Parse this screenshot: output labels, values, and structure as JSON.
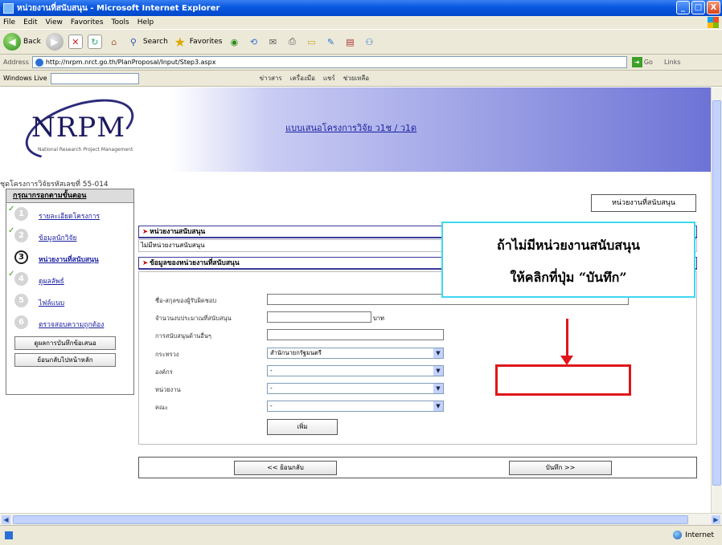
{
  "window": {
    "title": "หน่วยงานที่สนับสนุน - Microsoft Internet Explorer",
    "buttons": [
      "_",
      "□",
      "X"
    ]
  },
  "menubar": [
    "File",
    "Edit",
    "View",
    "Favorites",
    "Tools",
    "Help"
  ],
  "toolbar": {
    "back_label": "Back",
    "search_label": "Search",
    "favorites_label": "Favorites"
  },
  "addressbar": {
    "label": "Address",
    "url": "http://nrpm.nrct.go.th/PlanProposal/Input/Step3.aspx",
    "go_label": "Go",
    "links_label": "Links"
  },
  "livebar": {
    "brand": "Windows Live",
    "links": [
      "ข่าวสาร",
      "เครื่องมือ",
      "แชร์",
      "ช่วยเหลือ"
    ]
  },
  "page": {
    "banner_title": "แบบเสนอโครงการวิจัย ว1ช / ว1ด",
    "logo_text": "NRPM",
    "logo_tagline": "National Research Project Management",
    "project_line": "ชุดโครงการวิจัยรหัสเลขที่ 55-014"
  },
  "sidebar": {
    "heading": "กรุณากรอกตามขั้นตอน",
    "steps": [
      {
        "num": "1",
        "label": "รายละเอียดโครงการ",
        "done": true
      },
      {
        "num": "2",
        "label": "ข้อมูลนักวิจัย",
        "done": true
      },
      {
        "num": "3",
        "label": "หน่วยงานที่สนับสนุน",
        "done": false
      },
      {
        "num": "4",
        "label": "ดูผลลัพธ์",
        "done": true
      },
      {
        "num": "5",
        "label": "ไฟล์แนบ",
        "done": false
      },
      {
        "num": "6",
        "label": "ตรวจสอบความถูกต้อง",
        "done": false
      }
    ],
    "buttons": [
      "ดูผลการบันทึกข้อเสนอ",
      "ย้อนกลับไปหน้าหลัก"
    ]
  },
  "tab_label": "หน่วยงานที่สนับสนุน",
  "sections": {
    "s1_head": "หน่วยงานสนับสนุน",
    "s1_row": "ไม่มีหน่วยงานสนับสนุน",
    "s2_head": "ข้อมูลของหน่วยงานที่สนับสนุน"
  },
  "form": {
    "fields": [
      {
        "label": "ชื่อ-สกุลของผู้รับผิดชอบ"
      },
      {
        "label": "จำนวนงบประมาณที่สนับสนุน",
        "unit": "บาท"
      },
      {
        "label": "การสนับสนุนด้านอื่นๆ"
      },
      {
        "label": "กระทรวง",
        "value": "สำนักนายกรัฐมนตรี"
      },
      {
        "label": "องค์กร",
        "value": "-"
      },
      {
        "label": "หน่วยงาน",
        "value": "-"
      },
      {
        "label": "คณะ",
        "value": "-"
      }
    ],
    "add_button": "เพิ่ม"
  },
  "nav": {
    "back": "<< ย้อนกลับ",
    "save": "บันทึก >>"
  },
  "annotation": {
    "line1": "ถ้าไม่มีหน่วยงานสนับสนุน",
    "line2": "ให้คลิกที่ปุ่ม “บันทึก”"
  },
  "status": {
    "zone": "Internet"
  }
}
